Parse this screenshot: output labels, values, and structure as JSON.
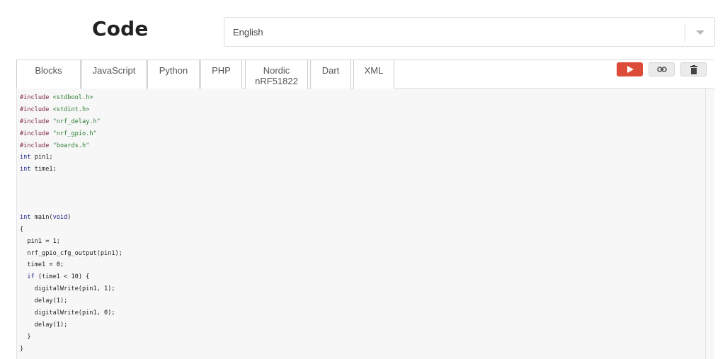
{
  "header": {
    "title": "Code",
    "language_select": {
      "value": "English"
    }
  },
  "tabs": [
    {
      "label": "Blocks",
      "label2": ""
    },
    {
      "label": "JavaScript",
      "label2": ""
    },
    {
      "label": "Python",
      "label2": ""
    },
    {
      "label": "PHP",
      "label2": ""
    },
    {
      "label": "Nordic",
      "label2": "nRF51822"
    },
    {
      "label": "Dart",
      "label2": ""
    },
    {
      "label": "XML",
      "label2": ""
    }
  ],
  "toolbar": {
    "run_icon": "play-icon",
    "link_icon": "link-icon",
    "trash_icon": "trash-icon",
    "run_color": "#dd4b39"
  },
  "editor": {
    "lines": [
      "#include <stdbool.h>",
      "#include <stdint.h>",
      "#include \"nrf_delay.h\"",
      "#include \"nrf_gpio.h\"",
      "#include \"boards.h\"",
      "int pin1;",
      "int time1;",
      "",
      "",
      "",
      "int main(void)",
      "{",
      "  pin1 = 1;",
      "  nrf_gpio_cfg_output(pin1);",
      "  time1 = 0;",
      "  if (time1 < 10) {",
      "    digitalWrite(pin1, 1);",
      "    delay(1);",
      "    digitalWrite(pin1, 0);",
      "    delay(1);",
      "  }",
      "}"
    ]
  }
}
